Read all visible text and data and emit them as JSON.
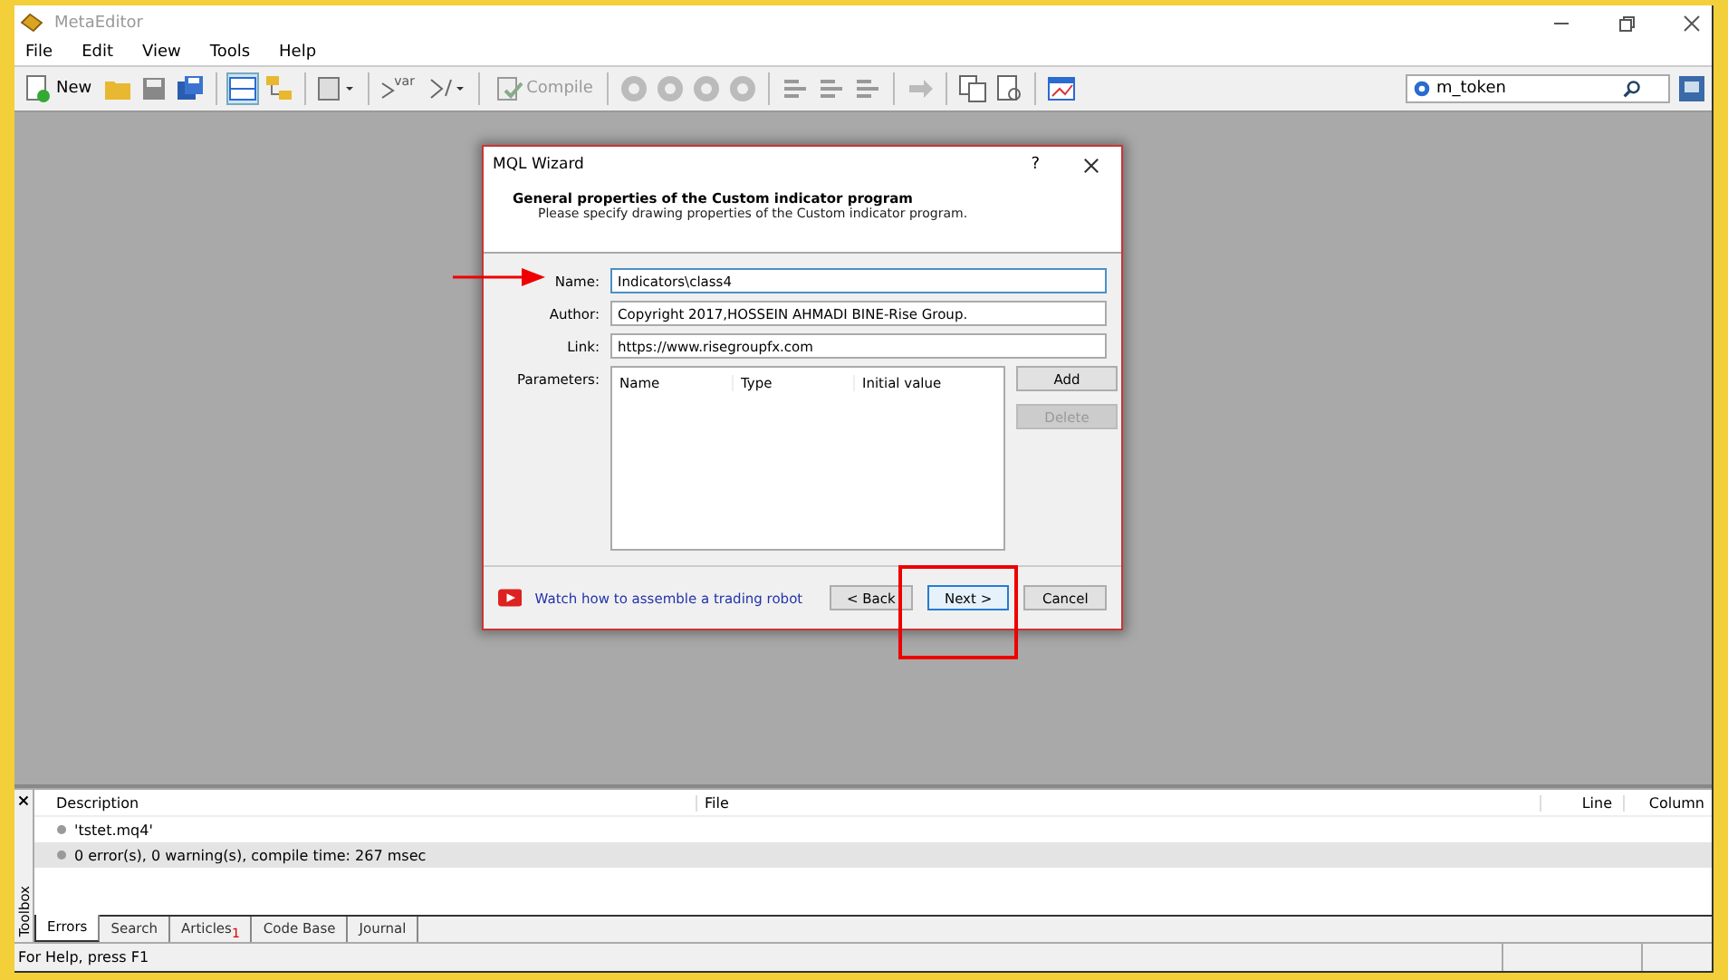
{
  "window": {
    "title": "MetaEditor"
  },
  "menu": [
    {
      "label": "File"
    },
    {
      "label": "Edit"
    },
    {
      "label": "View"
    },
    {
      "label": "Tools"
    },
    {
      "label": "Help"
    }
  ],
  "toolbar": {
    "new_label": "New",
    "compile": {
      "label": "Compile",
      "disabled": true
    },
    "var_label": "var"
  },
  "search": {
    "value": "m_token"
  },
  "dialog": {
    "title": "MQL Wizard",
    "help": "?",
    "heading": "General properties of the Custom indicator program",
    "subheading": "Please specify drawing properties of the Custom indicator program.",
    "fields": [
      {
        "label": "Name:",
        "value": "Indicators\\class4",
        "focused": true
      },
      {
        "label": "Author:",
        "value": "Copyright 2017,HOSSEIN AHMADI BINE-Rise Group.",
        "focused": false
      },
      {
        "label": "Link:",
        "value": "https://www.risegroupfx.com",
        "focused": false
      }
    ],
    "parameters": {
      "label": "Parameters:",
      "columns": [
        "Name",
        "Type",
        "Initial value"
      ]
    },
    "side_buttons": [
      {
        "label": "Add",
        "disabled": false
      },
      {
        "label": "Delete",
        "disabled": true
      }
    ],
    "link": "Watch how to assemble a trading robot",
    "nav_buttons": [
      {
        "label": "< Back",
        "default": false
      },
      {
        "label": "Next >",
        "default": true
      },
      {
        "label": "Cancel",
        "default": false
      }
    ]
  },
  "toolbox": {
    "label": "Toolbox",
    "columns": [
      "Description",
      "File",
      "Line",
      "Column"
    ],
    "rows": [
      {
        "text": "'tstet.mq4'",
        "selected": false
      },
      {
        "text": "0 error(s), 0 warning(s), compile time: 267 msec",
        "selected": true
      }
    ],
    "tabs": [
      {
        "label": "Errors",
        "selected": true
      },
      {
        "label": "Search",
        "selected": false
      },
      {
        "label": "Articles",
        "selected": false,
        "badge": "1"
      },
      {
        "label": "Code Base",
        "selected": false
      },
      {
        "label": "Journal",
        "selected": false
      }
    ]
  },
  "status_bar": {
    "text": "For Help, press F1"
  }
}
